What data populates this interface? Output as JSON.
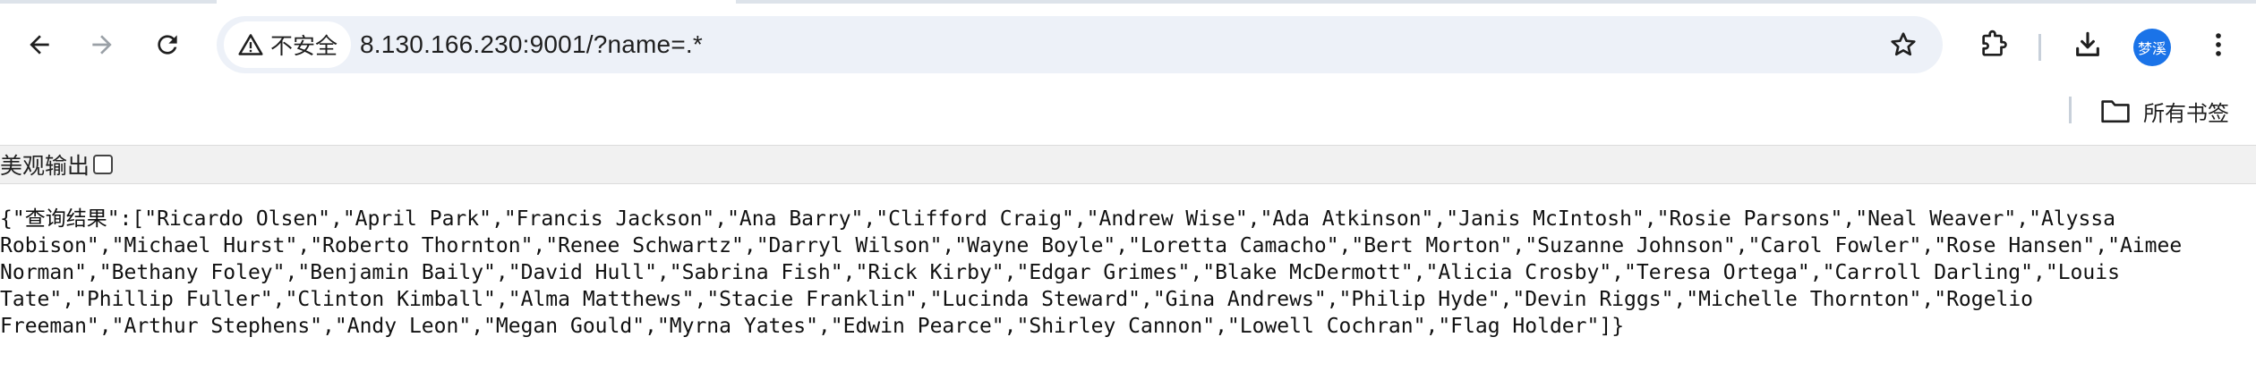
{
  "browser": {
    "security_chip": {
      "label": "不安全",
      "icon": "warning-triangle-icon"
    },
    "address_bar": {
      "url": "8.130.166.230:9001/?name=.*"
    },
    "profile": {
      "avatar_text": "梦溪",
      "color": "#1a73e8"
    },
    "bookmarks_bar": {
      "all_bookmarks_label": "所有书签"
    },
    "icons": [
      "back-arrow-icon",
      "forward-arrow-icon",
      "reload-icon",
      "star-icon",
      "extensions-icon",
      "download-icon",
      "more-menu-icon",
      "folder-icon"
    ]
  },
  "page": {
    "prettify_label": "美观输出",
    "prettify_checked": false,
    "result_key": "查询结果",
    "names": [
      "Ricardo Olsen",
      "April Park",
      "Francis Jackson",
      "Ana Barry",
      "Clifford Craig",
      "Andrew Wise",
      "Ada Atkinson",
      "Janis McIntosh",
      "Rosie Parsons",
      "Neal Weaver",
      "Alyssa Robison",
      "Michael Hurst",
      "Roberto Thornton",
      "Renee Schwartz",
      "Darryl Wilson",
      "Wayne Boyle",
      "Loretta Camacho",
      "Bert Morton",
      "Suzanne Johnson",
      "Carol Fowler",
      "Rose Hansen",
      "Aimee Norman",
      "Bethany Foley",
      "Benjamin Baily",
      "David Hull",
      "Sabrina Fish",
      "Rick Kirby",
      "Edgar Grimes",
      "Blake McDermott",
      "Alicia Crosby",
      "Teresa Ortega",
      "Carroll Darling",
      "Louis Tate",
      "Phillip Fuller",
      "Clinton Kimball",
      "Alma Matthews",
      "Stacie Franklin",
      "Lucinda Steward",
      "Gina Andrews",
      "Philip Hyde",
      "Devin Riggs",
      "Michelle Thornton",
      "Rogelio Freeman",
      "Arthur Stephens",
      "Andy Leon",
      "Megan Gould",
      "Myrna Yates",
      "Edwin Pearce",
      "Shirley Cannon",
      "Lowell Cochran",
      "Flag Holder"
    ]
  }
}
